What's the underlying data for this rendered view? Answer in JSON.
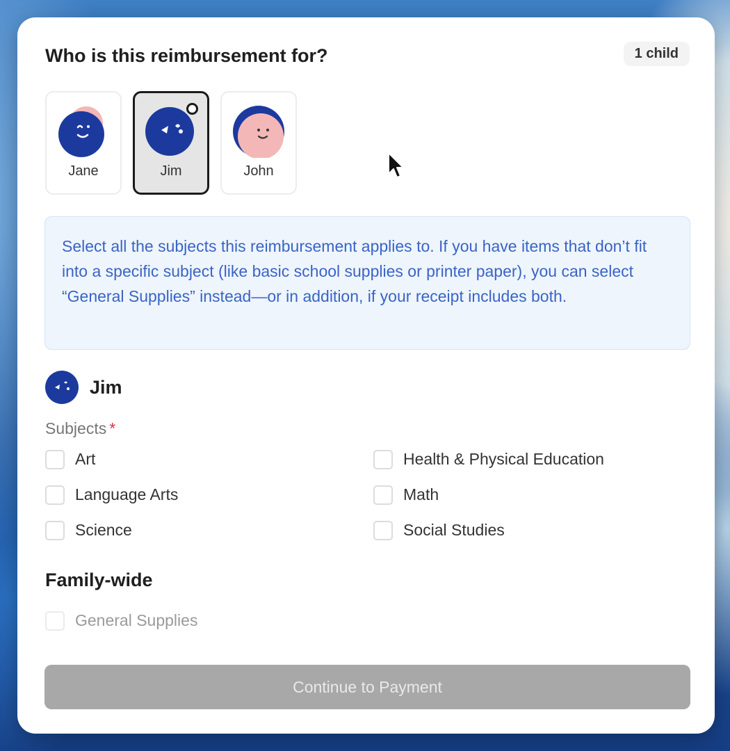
{
  "dialog": {
    "title": "Who is this reimbursement for?",
    "count_badge": "1 child"
  },
  "children": [
    {
      "name": "Jane",
      "selected": false
    },
    {
      "name": "Jim",
      "selected": true
    },
    {
      "name": "John",
      "selected": false
    }
  ],
  "info": {
    "text": "Select all the subjects this reimbursement applies to. If you have items that don’t fit into a specific subject (like basic school supplies or printer paper), you can select “General Supplies” instead—or in addition, if your receipt includes both."
  },
  "student": {
    "name": "Jim",
    "subjects_label": "Subjects",
    "required_marker": "*",
    "subjects": [
      {
        "label": "Art",
        "checked": false
      },
      {
        "label": "Health & Physical Education",
        "checked": false
      },
      {
        "label": "Language Arts",
        "checked": false
      },
      {
        "label": "Math",
        "checked": false
      },
      {
        "label": "Science",
        "checked": false
      },
      {
        "label": "Social Studies",
        "checked": false
      }
    ]
  },
  "family": {
    "title": "Family-wide",
    "general_label": "General Supplies",
    "general_checked": false
  },
  "actions": {
    "continue_label": "Continue to Payment"
  },
  "colors": {
    "avatar_navy": "#1c3a9e",
    "avatar_pink": "#f3b7b7",
    "info_text": "#3a64c5",
    "required": "#e0333a",
    "button_disabled": "#a8a8a8"
  }
}
